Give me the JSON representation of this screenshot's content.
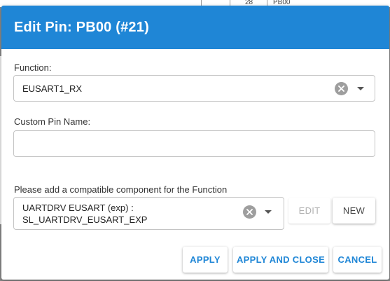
{
  "background": {
    "cell_number": "28",
    "cell_pin": "PB00"
  },
  "dialog": {
    "title": "Edit Pin: PB00 (#21)",
    "header_color": "#1f86d6",
    "function": {
      "label": "Function:",
      "value": "EUSART1_RX"
    },
    "custom_name": {
      "label": "Custom Pin Name:",
      "value": "",
      "placeholder": ""
    },
    "component": {
      "label": "Please add a compatible component for the Function",
      "value_line1": "UARTDRV EUSART (exp) :",
      "value_line2": "SL_UARTDRV_EUSART_EXP",
      "edit_label": "EDIT",
      "new_label": "NEW"
    },
    "footer": {
      "apply_label": "APPLY",
      "apply_close_label": "APPLY AND CLOSE",
      "cancel_label": "CANCEL"
    }
  }
}
